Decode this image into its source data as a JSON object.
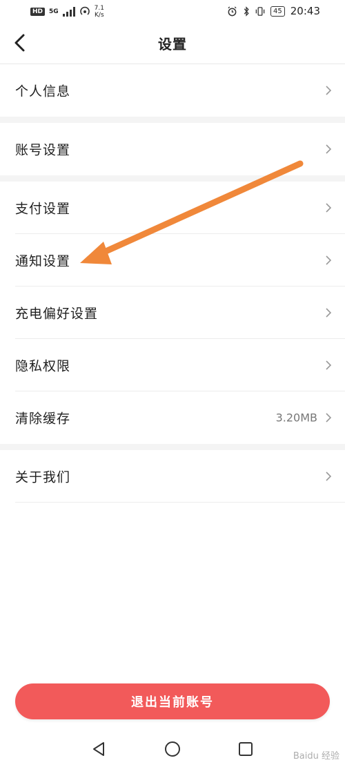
{
  "status_bar": {
    "hd": "HD",
    "network": "5G",
    "speed_value": "7.1",
    "speed_unit": "K/s",
    "battery": "45",
    "time": "20:43"
  },
  "header": {
    "title": "设置"
  },
  "settings": {
    "personal_info": "个人信息",
    "account": "账号设置",
    "payment": "支付设置",
    "notification": "通知设置",
    "charging_pref": "充电偏好设置",
    "privacy": "隐私权限",
    "clear_cache": "清除缓存",
    "cache_size": "3.20MB",
    "about": "关于我们"
  },
  "logout": {
    "label": "退出当前账号"
  },
  "watermark": "Baidu 经验",
  "colors": {
    "accent": "#f25a5a",
    "annotation_arrow": "#f0883a",
    "section_gap": "#f4f4f4"
  }
}
